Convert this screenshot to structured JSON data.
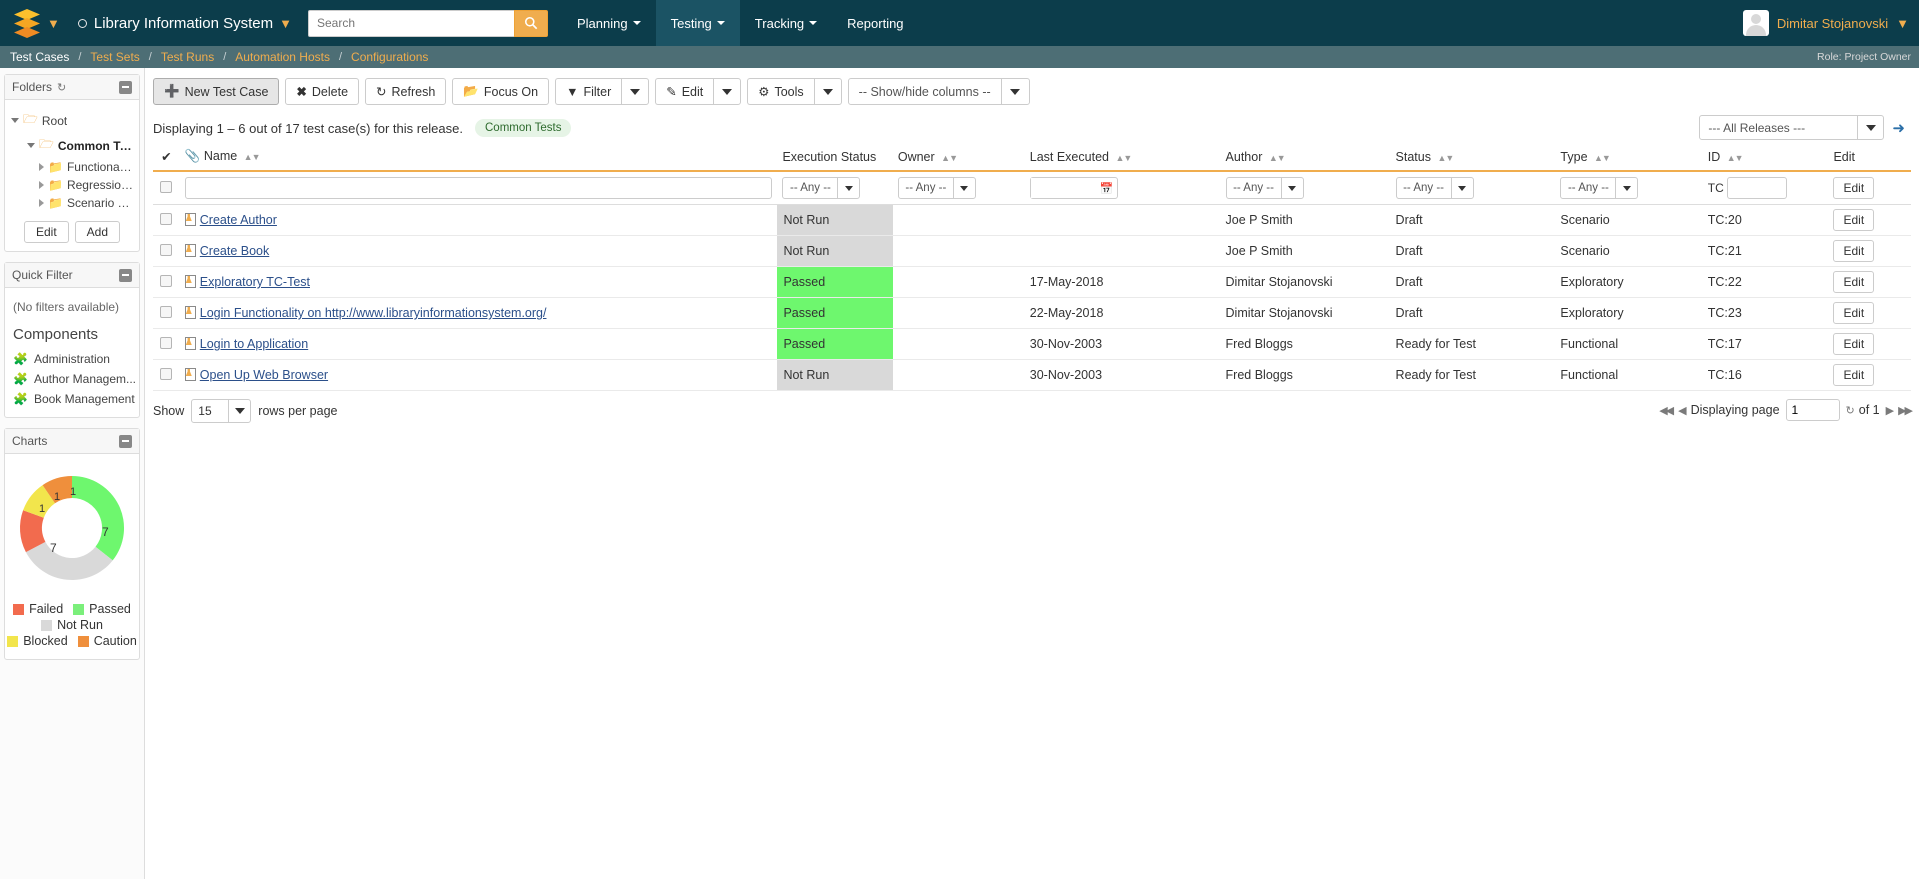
{
  "header": {
    "project_name": "Library Information System",
    "search_placeholder": "Search",
    "search_value": "",
    "search_icon": "search-icon",
    "nav": [
      {
        "label": "Planning",
        "active": false
      },
      {
        "label": "Testing",
        "active": true
      },
      {
        "label": "Tracking",
        "active": false
      },
      {
        "label": "Reporting",
        "active": false
      }
    ],
    "user_name": "Dimitar Stojanovski"
  },
  "breadcrumb": {
    "items": [
      {
        "label": "Test Cases",
        "current": true
      },
      {
        "label": "Test Sets",
        "current": false
      },
      {
        "label": "Test Runs",
        "current": false
      },
      {
        "label": "Automation Hosts",
        "current": false
      },
      {
        "label": "Configurations",
        "current": false
      }
    ],
    "separator": "/",
    "role": "Role: Project Owner"
  },
  "sidebar": {
    "folders_panel": {
      "title": "Folders",
      "tree": [
        {
          "label": "Root",
          "level": 0,
          "expanded": true,
          "bold": false
        },
        {
          "label": "Common Tests",
          "level": 1,
          "expanded": true,
          "bold": true
        },
        {
          "label": "Functional Tes",
          "level": 2,
          "expanded": false,
          "bold": false
        },
        {
          "label": "Regression Tes",
          "level": 2,
          "expanded": false,
          "bold": false
        },
        {
          "label": "Scenario Tests",
          "level": 2,
          "expanded": false,
          "bold": false
        }
      ],
      "edit_label": "Edit",
      "add_label": "Add"
    },
    "quick_filter_panel": {
      "title": "Quick Filter",
      "empty_text": "(No filters available)"
    },
    "components": {
      "title": "Components",
      "items": [
        "Administration",
        "Author Managem...",
        "Book Management"
      ]
    },
    "charts_panel": {
      "title": "Charts"
    }
  },
  "chart_data": {
    "type": "pie",
    "title": "Charts",
    "categories": [
      "Passed",
      "Not Run",
      "Failed",
      "Blocked",
      "Caution"
    ],
    "values": [
      7,
      7,
      1,
      1,
      1
    ],
    "colors": [
      "#7bef7b",
      "#d9d9d9",
      "#f26b4e",
      "#f2e54c",
      "#ef8f3c"
    ],
    "legend": [
      {
        "label": "Failed",
        "color": "#f26b4e"
      },
      {
        "label": "Passed",
        "color": "#7bef7b"
      },
      {
        "label": "Not Run",
        "color": "#d9d9d9"
      },
      {
        "label": "Blocked",
        "color": "#f2e54c"
      },
      {
        "label": "Caution",
        "color": "#ef8f3c"
      }
    ],
    "legend_position": "bottom",
    "donut": true
  },
  "toolbar": {
    "new_test_case": "New Test Case",
    "delete": "Delete",
    "refresh": "Refresh",
    "focus_on": "Focus On",
    "filter": "Filter",
    "edit": "Edit",
    "tools": "Tools",
    "show_hide_columns": "-- Show/hide columns --"
  },
  "info": {
    "text": "Displaying 1 – 6 out of 17 test case(s) for this release.",
    "tag": "Common Tests",
    "release_selected": "--- All Releases ---"
  },
  "table": {
    "columns": [
      {
        "key": "check",
        "label": ""
      },
      {
        "key": "name",
        "label": "Name",
        "sortable": true
      },
      {
        "key": "execution_status",
        "label": "Execution Status",
        "sortable": false
      },
      {
        "key": "owner",
        "label": "Owner",
        "sortable": true
      },
      {
        "key": "last_executed",
        "label": "Last Executed",
        "sortable": true
      },
      {
        "key": "author",
        "label": "Author",
        "sortable": true
      },
      {
        "key": "status",
        "label": "Status",
        "sortable": true
      },
      {
        "key": "type",
        "label": "Type",
        "sortable": true
      },
      {
        "key": "id",
        "label": "ID",
        "sortable": true
      },
      {
        "key": "edit",
        "label": "Edit",
        "sortable": false
      }
    ],
    "filters": {
      "name_value": "",
      "execution_status": "-- Any --",
      "owner": "-- Any --",
      "last_executed_value": "",
      "author": "-- Any --",
      "status": "-- Any --",
      "type": "-- Any --",
      "id_prefix": "TC",
      "id_value": "",
      "edit_label": "Edit"
    },
    "rows": [
      {
        "name": "Create Author",
        "execution_status": "Not Run",
        "exec_color": "#d9d9d9",
        "owner": "",
        "last_executed": "",
        "author": "Joe P Smith",
        "status": "Draft",
        "type": "Scenario",
        "id": "TC:20",
        "edit": "Edit"
      },
      {
        "name": "Create Book",
        "execution_status": "Not Run",
        "exec_color": "#d9d9d9",
        "owner": "",
        "last_executed": "",
        "author": "Joe P Smith",
        "status": "Draft",
        "type": "Scenario",
        "id": "TC:21",
        "edit": "Edit"
      },
      {
        "name": "Exploratory TC-Test",
        "execution_status": "Passed",
        "exec_color": "#6ef76e",
        "owner": "",
        "last_executed": "17-May-2018",
        "author": "Dimitar Stojanovski",
        "status": "Draft",
        "type": "Exploratory",
        "id": "TC:22",
        "edit": "Edit"
      },
      {
        "name": "Login Functionality on http://www.libraryinformationsystem.org/",
        "execution_status": "Passed",
        "exec_color": "#6ef76e",
        "owner": "",
        "last_executed": "22-May-2018",
        "author": "Dimitar Stojanovski",
        "status": "Draft",
        "type": "Exploratory",
        "id": "TC:23",
        "edit": "Edit"
      },
      {
        "name": "Login to Application",
        "execution_status": "Passed",
        "exec_color": "#6ef76e",
        "owner": "",
        "last_executed": "30-Nov-2003",
        "author": "Fred Bloggs",
        "status": "Ready for Test",
        "type": "Functional",
        "id": "TC:17",
        "edit": "Edit"
      },
      {
        "name": "Open Up Web Browser",
        "execution_status": "Not Run",
        "exec_color": "#d9d9d9",
        "owner": "",
        "last_executed": "30-Nov-2003",
        "author": "Fred Bloggs",
        "status": "Ready for Test",
        "type": "Functional",
        "id": "TC:16",
        "edit": "Edit"
      }
    ]
  },
  "footer": {
    "show_label": "Show",
    "rows_per_page_value": "15",
    "rows_per_page_label": "rows per page",
    "displaying_page_label": "Displaying page",
    "page_value": "1",
    "of_label": "of 1"
  }
}
